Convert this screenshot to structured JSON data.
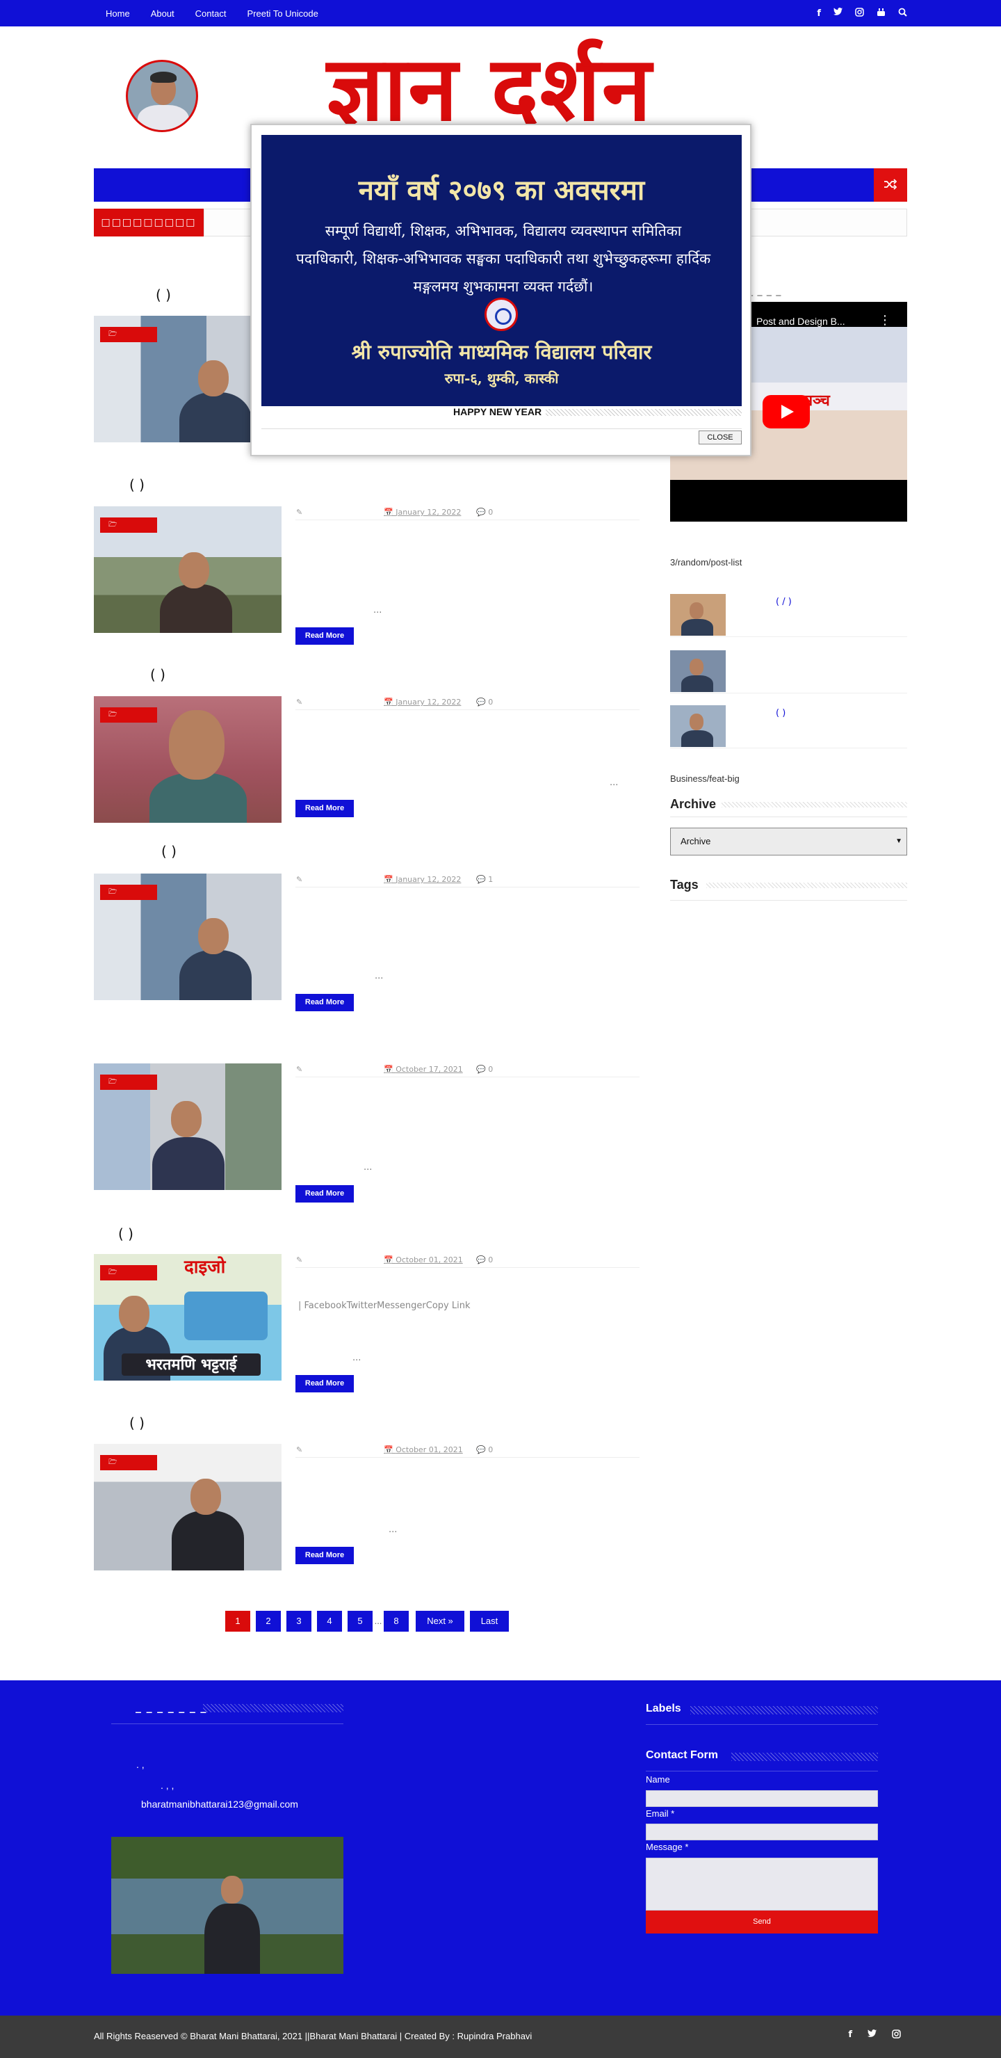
{
  "nav": {
    "items": [
      "Home",
      "About",
      "Contact",
      "Preeti To Unicode"
    ],
    "social_icons": [
      "facebook-icon",
      "twitter-icon",
      "instagram-icon",
      "youtube-icon",
      "search-icon"
    ]
  },
  "header": {
    "logo_text": "ज्ञान दर्शन"
  },
  "ticker": {
    "label": "□□□□□□□□□"
  },
  "posts": [
    {
      "title_fragment": "(        )",
      "category_icon": "folder-icon",
      "date": "",
      "comments": "",
      "excerpt": "",
      "read_more": ""
    },
    {
      "title_fragment": "(        )",
      "category_icon": "folder-icon",
      "date": "January 12, 2022",
      "comments": "0",
      "excerpt": "...",
      "read_more": "Read More"
    },
    {
      "title_fragment": "(        )",
      "category_icon": "folder-icon",
      "date": "January 12, 2022",
      "comments": "0",
      "excerpt": "...",
      "read_more": "Read More"
    },
    {
      "title_fragment": "(        )",
      "category_icon": "folder-icon",
      "date": "January 12, 2022",
      "comments": "1",
      "excerpt": "...",
      "read_more": "Read More"
    },
    {
      "title_fragment": "",
      "category_icon": "folder-icon",
      "date": "October 17, 2021",
      "comments": "0",
      "excerpt": "...",
      "read_more": "Read More"
    },
    {
      "title_fragment": "(        )",
      "category_icon": "folder-icon",
      "date": "October 01, 2021",
      "comments": "0",
      "excerpt": "...",
      "share_text": "|        FacebookTwitterMessengerCopy        Link",
      "read_more": "Read More",
      "thumb_top_text": "दाइजो",
      "thumb_bottom_text": "भरतमणि भट्टराई"
    },
    {
      "title_fragment": "(        )",
      "category_icon": "folder-icon",
      "date": "October 01, 2021",
      "comments": "0",
      "excerpt": "...",
      "read_more": "Read More"
    }
  ],
  "pagination": {
    "pages": [
      "1",
      "2",
      "3",
      "4",
      "5",
      "...",
      "8"
    ],
    "next": "Next »",
    "last": "Last"
  },
  "sidebar": {
    "dashes": "_ _ _ _",
    "video_title": "Post and Design B...",
    "random_widget_text": "3/random/post-list",
    "random_items": [
      {
        "link_text": "(     /      )"
      },
      {
        "link_text": ""
      },
      {
        "link_text": "(       )"
      }
    ],
    "feat_text": "Business/feat-big",
    "archive_heading": "Archive",
    "archive_select": "Archive",
    "tags_heading": "Tags"
  },
  "footer": {
    "dashes": "_ _ _ _ _ _ _",
    "line1": ".  ,",
    "line2": ".  ,          ,",
    "email": "bharatmanibhattarai123@gmail.com",
    "labels_heading": "Labels",
    "contact_heading": "Contact Form",
    "name_label": "Name",
    "email_label": "Email *",
    "message_label": "Message *",
    "send_label": "Send"
  },
  "bottombar": {
    "copyright": "All Rights Reaserved © Bharat Mani Bhattarai, 2021 ||Bharat Mani Bhattarai | Created By : Rupindra Prabhavi",
    "social_icons": [
      "facebook-icon",
      "twitter-icon",
      "instagram-icon"
    ]
  },
  "popup": {
    "heading": "नयाँ वर्ष २०७९ का अवसरमा",
    "body": "सम्पूर्ण विद्यार्थी, शिक्षक, अभिभावक, विद्यालय व्यवस्थापन समितिका पदाधिकारी, शिक्षक-अभिभावक सङ्घका पदाधिकारी तथा शुभेच्छुकहरूमा हार्दिक मङ्गलमय शुभकामना व्यक्त गर्दछौं।",
    "school": "श्री रुपाज्योति माध्यमिक विद्यालय परिवार",
    "address": "रुपा-६, थुम्की, कास्की",
    "caption": "HAPPY NEW YEAR",
    "close_label": "CLOSE"
  },
  "colors": {
    "primary_blue": "#1010d6",
    "accent_red": "#d90b0b",
    "popup_navy": "#0b1a6b",
    "popup_gold": "#f3e6a8",
    "bottom_dark": "#3b3b3b"
  }
}
